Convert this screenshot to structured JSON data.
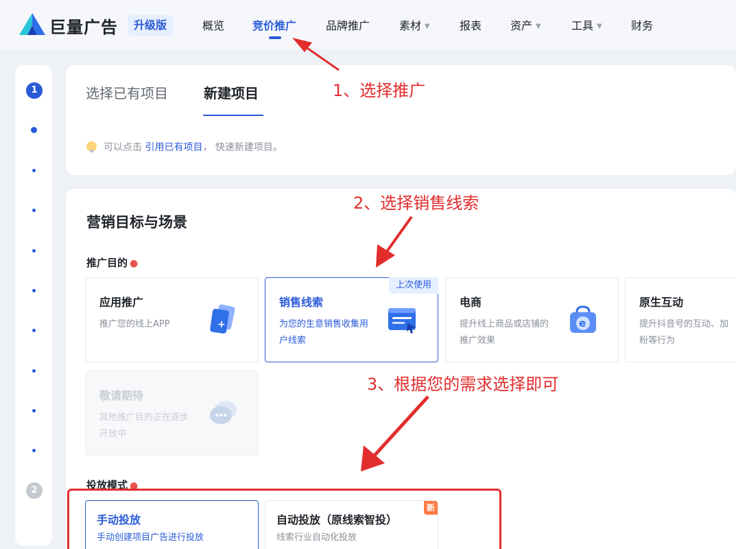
{
  "brand": {
    "name": "巨量广告",
    "badge": "升级版"
  },
  "nav": [
    {
      "label": "概览",
      "dropdown": false,
      "active": false
    },
    {
      "label": "竞价推广",
      "dropdown": false,
      "active": true
    },
    {
      "label": "品牌推广",
      "dropdown": false,
      "active": false
    },
    {
      "label": "素材",
      "dropdown": true,
      "active": false
    },
    {
      "label": "报表",
      "dropdown": false,
      "active": false
    },
    {
      "label": "资产",
      "dropdown": true,
      "active": false
    },
    {
      "label": "工具",
      "dropdown": true,
      "active": false
    },
    {
      "label": "财务",
      "dropdown": false,
      "active": false
    }
  ],
  "stepper": {
    "step1": "1",
    "step2": "2"
  },
  "project_tabs": {
    "existing": "选择已有项目",
    "new": "新建项目"
  },
  "tip": {
    "before": "可以点击 ",
    "link": "引用已有项目",
    "after": "， 快速新建项目。"
  },
  "marketing": {
    "section_title": "营销目标与场景",
    "goal_label": "推广目的",
    "goal_options": [
      {
        "title": "应用推广",
        "desc": "推广您的线上APP",
        "icon": "app-promotion-icon",
        "state": "normal"
      },
      {
        "title": "销售线索",
        "desc": "为您的生意销售收集用户线索",
        "icon": "sales-leads-icon",
        "state": "selected",
        "tag": "上次使用"
      },
      {
        "title": "电商",
        "desc": "提升线上商品或店铺的推广效果",
        "icon": "ecommerce-icon",
        "state": "normal"
      },
      {
        "title": "原生互动",
        "desc": "提升抖音号的互动、加粉等行为",
        "icon": "",
        "state": "normal"
      },
      {
        "title": "敬请期待",
        "desc": "其他推广目的正在逐步开放中",
        "icon": "chat-bubble-icon",
        "state": "disabled"
      }
    ],
    "mode_label": "投放模式",
    "mode_options": [
      {
        "title": "手动投放",
        "desc": "手动创建项目广告进行投放",
        "state": "selected"
      },
      {
        "title": "自动投放（原线索智投）",
        "desc": "线索行业自动化投放",
        "state": "normal",
        "tag": "新"
      }
    ]
  },
  "annotations": {
    "step1": "1、选择推广",
    "step2": "2、选择销售线索",
    "step3": "3、根据您的需求选择即可"
  },
  "colors": {
    "accent": "#2a5bd7",
    "annotation": "#e22d2d",
    "background": "#eef1f6"
  }
}
